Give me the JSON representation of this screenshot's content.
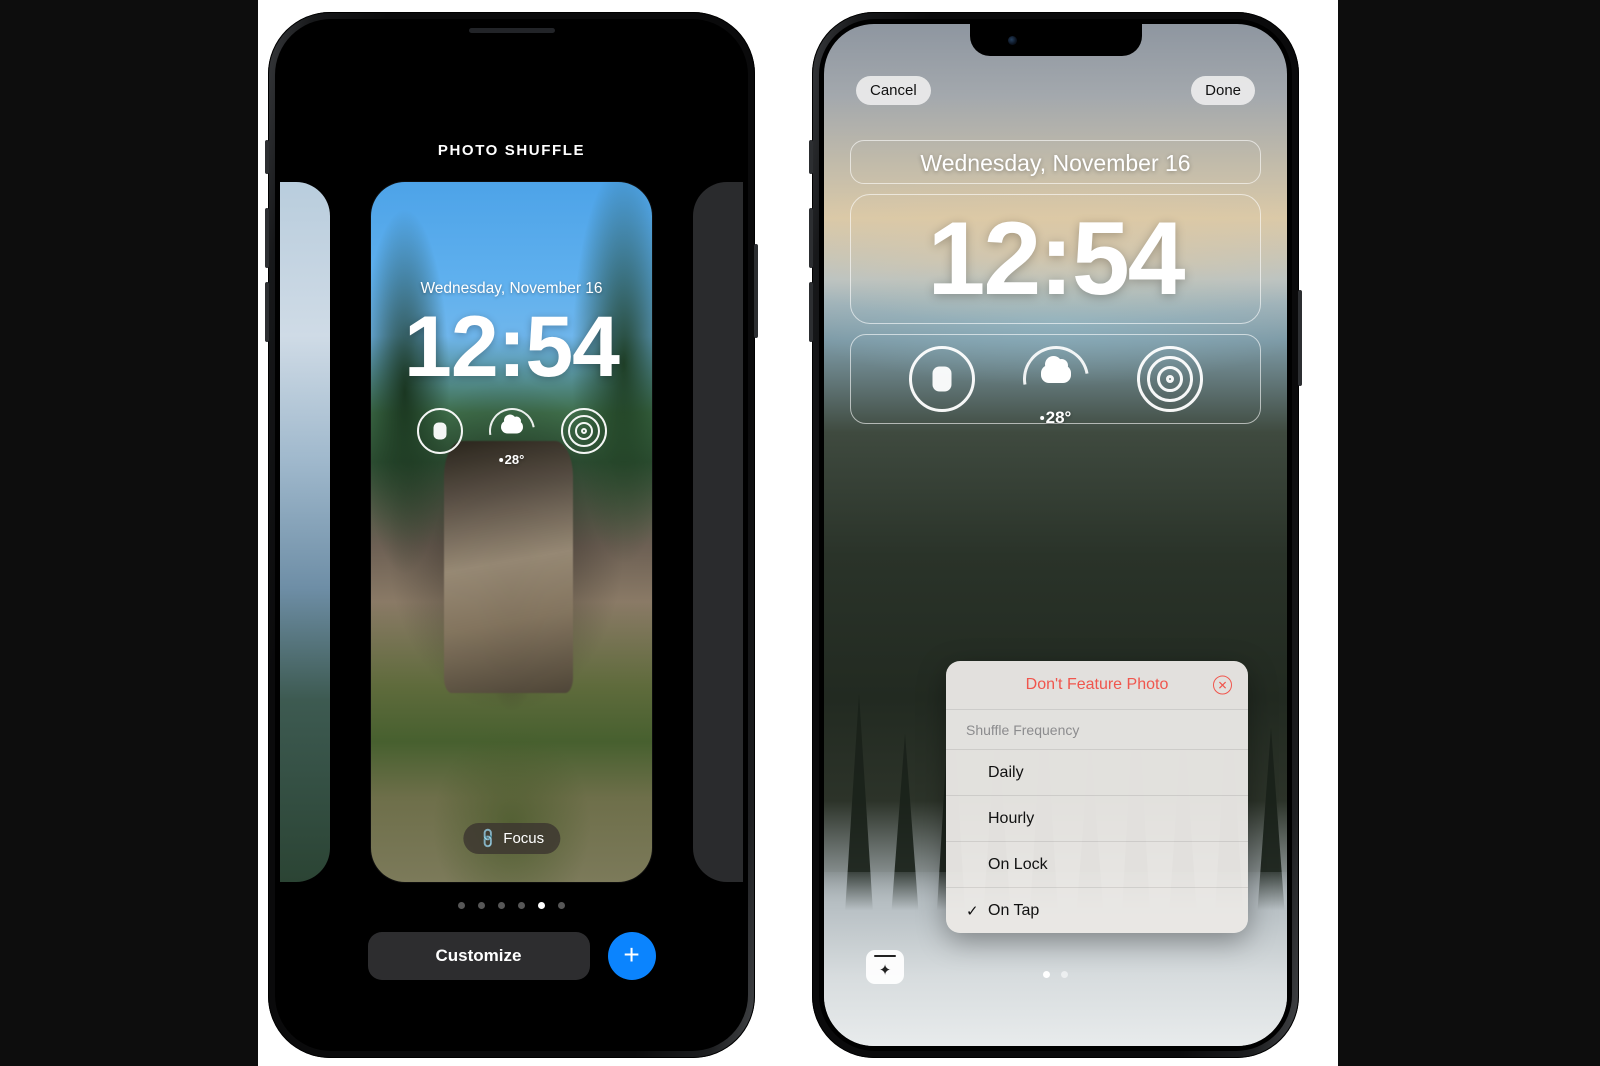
{
  "canvas": {
    "background": "#0d0d0d",
    "plate_background": "#ffffff"
  },
  "left_phone": {
    "header_label": "PHOTO SHUFFLE",
    "lock_screen": {
      "date": "Wednesday, November 16",
      "time": "12:54",
      "widgets": [
        {
          "name": "activity-rings-widget",
          "icon": "activity-rings-icon",
          "value": ""
        },
        {
          "name": "weather-widget",
          "icon": "cloud-icon",
          "value": "28°"
        },
        {
          "name": "concentric-rings-widget",
          "icon": "concentric-rings-icon",
          "value": ""
        }
      ],
      "focus_pill": {
        "icon": "link-icon",
        "label": "Focus"
      }
    },
    "page_dots": {
      "count": 6,
      "active_index": 4
    },
    "customize_label": "Customize",
    "add_label": "+",
    "accent_blue": "#0b84fe"
  },
  "right_phone": {
    "top_bar": {
      "cancel_label": "Cancel",
      "done_label": "Done"
    },
    "lock_screen": {
      "date": "Wednesday, November 16",
      "time": "12:54",
      "widgets": [
        {
          "name": "activity-rings-widget",
          "icon": "activity-rings-icon",
          "value": ""
        },
        {
          "name": "weather-widget",
          "icon": "cloud-icon",
          "value": "28°"
        },
        {
          "name": "concentric-rings-widget",
          "icon": "concentric-rings-icon",
          "value": ""
        }
      ]
    },
    "context_menu": {
      "destructive_label": "Don't Feature Photo",
      "destructive_color": "#f0564d",
      "close_icon": "circle-x-icon",
      "section_header": "Shuffle Frequency",
      "options": [
        {
          "label": "Daily",
          "checked": false
        },
        {
          "label": "Hourly",
          "checked": false
        },
        {
          "label": "On Lock",
          "checked": false
        },
        {
          "label": "On Tap",
          "checked": true
        }
      ],
      "check_glyph": "✓"
    },
    "effects_button": {
      "icon": "photo-effects-sparkle-icon"
    },
    "page_dots": {
      "count": 2,
      "active_index": 0
    }
  }
}
